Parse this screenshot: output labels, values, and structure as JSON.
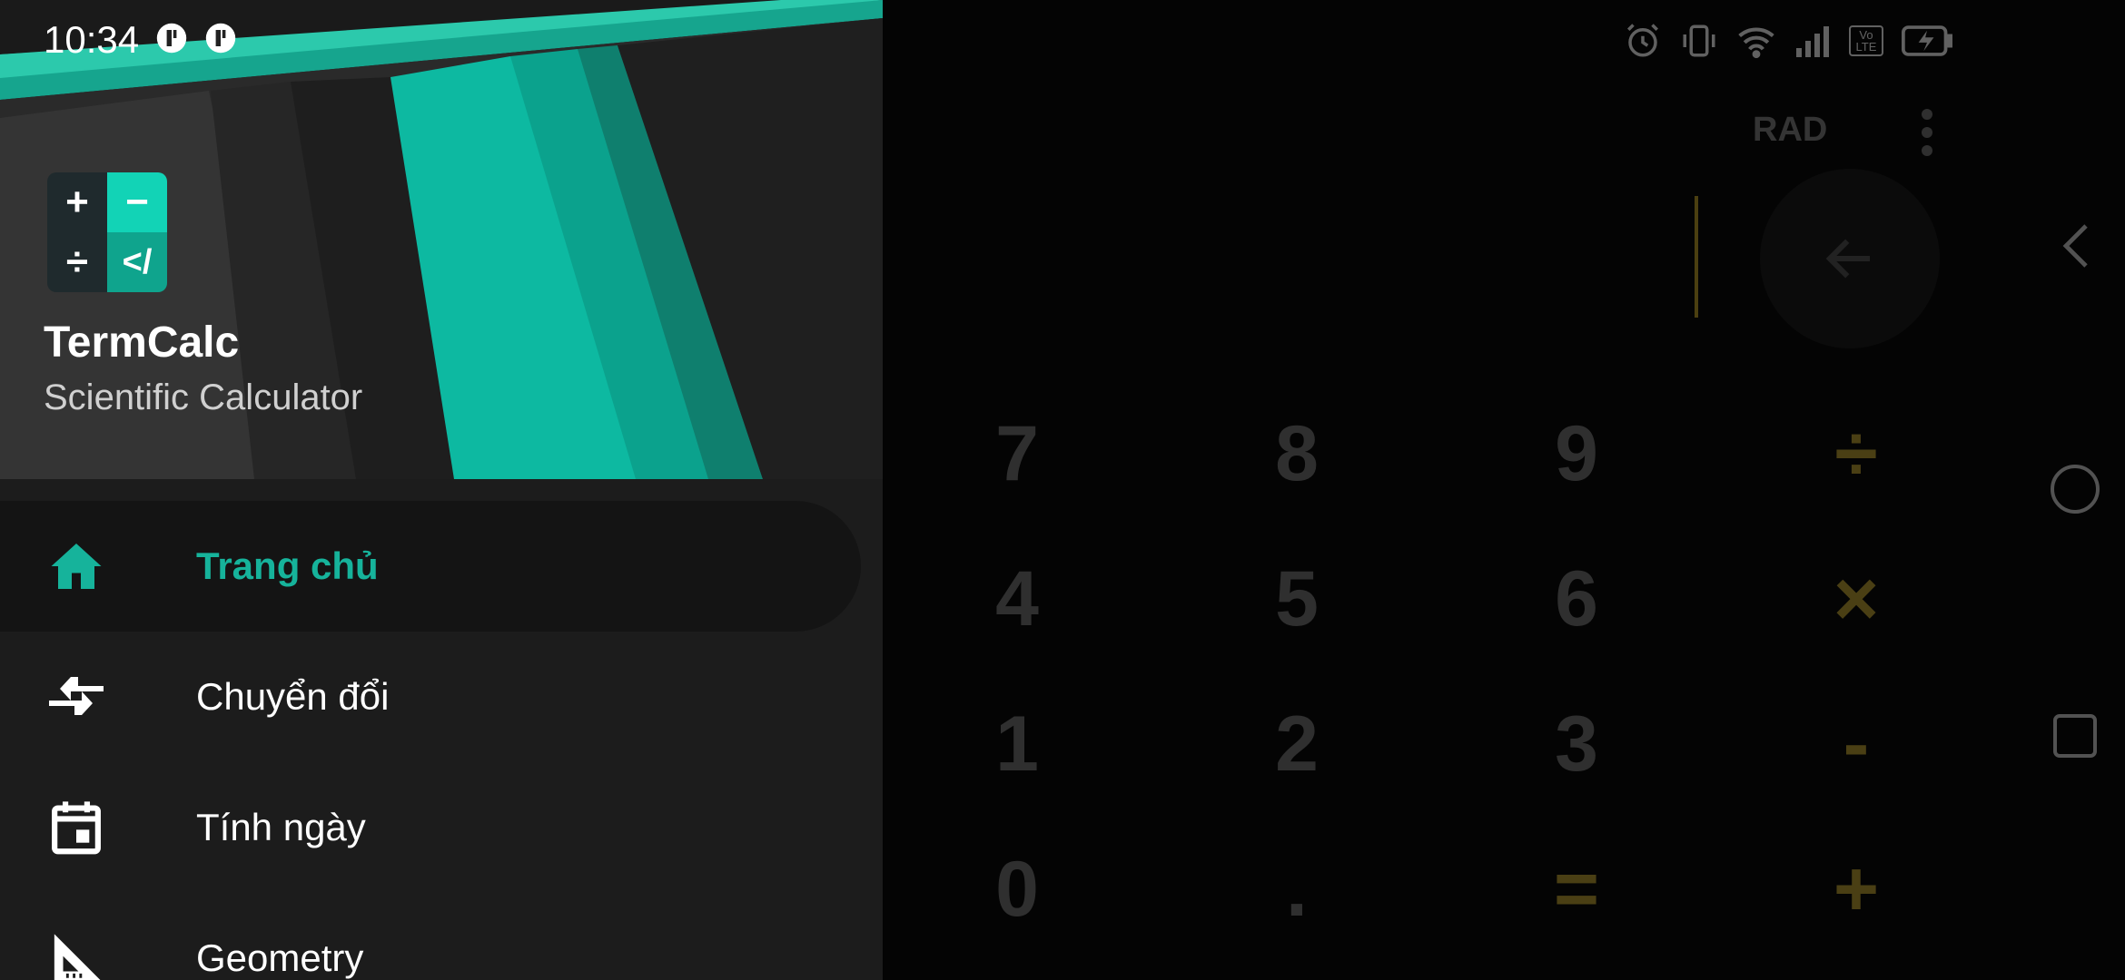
{
  "status_bar": {
    "time": "10:34",
    "right_icons": [
      "alarm-icon",
      "vibrate-icon",
      "wifi-icon",
      "signal-icon",
      "volte-icon",
      "battery-charging-icon"
    ],
    "volte_text": "Vo LTE"
  },
  "drawer": {
    "app_name": "TermCalc",
    "app_subtitle": "Scientific Calculator",
    "logo_symbols": [
      "+",
      "−",
      "÷",
      "</"
    ],
    "accent_color": "#16b39b",
    "items": [
      {
        "label": "Trang chủ",
        "icon": "home-icon",
        "active": true
      },
      {
        "label": "Chuyển đổi",
        "icon": "convert-arrows-icon",
        "active": false
      },
      {
        "label": "Tính ngày",
        "icon": "calendar-icon",
        "active": false
      },
      {
        "label": "Geometry",
        "icon": "set-square-icon",
        "active": false
      }
    ]
  },
  "calculator": {
    "angle_mode": "RAD",
    "keys": [
      [
        "7",
        "8",
        "9",
        "÷"
      ],
      [
        "4",
        "5",
        "6",
        "×"
      ],
      [
        "1",
        "2",
        "3",
        "-"
      ],
      [
        "0",
        ".",
        "=",
        "+"
      ]
    ],
    "operator_color": "#c2a636"
  },
  "navigation_bar": {
    "buttons": [
      "back-icon",
      "home-circle-icon",
      "recents-square-icon"
    ]
  }
}
